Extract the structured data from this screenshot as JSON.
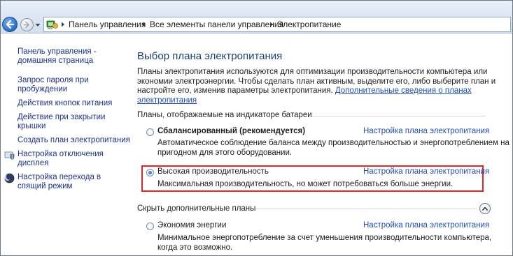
{
  "breadcrumb": {
    "items": [
      "Панель управления",
      "Все элементы панели управления",
      "Электропитание"
    ]
  },
  "icons": {
    "back": "back-arrow-icon",
    "forward": "forward-arrow-icon",
    "history": "chevron-down-icon",
    "control_panel": "control-panel-icon",
    "separator": "chevron-right-icon",
    "shield_display": "shield-icon",
    "moon_sleep": "moon-icon",
    "collapse": "chevron-up-icon"
  },
  "sidebar": {
    "items": [
      {
        "lines": [
          "Панель управления -",
          "домашняя страница"
        ]
      },
      {
        "lines": [
          "Запрос пароля при",
          "пробуждении"
        ]
      },
      {
        "lines": [
          "Действия кнопок питания"
        ]
      },
      {
        "lines": [
          "Действие при закрытии",
          "крышки"
        ]
      },
      {
        "lines": [
          "Создать план электропитания"
        ]
      },
      {
        "lines": [
          "Настройка отключения",
          "дисплея"
        ]
      },
      {
        "lines": [
          "Настройка перехода в",
          "спящий режим"
        ]
      }
    ]
  },
  "main": {
    "title": "Выбор плана электропитания",
    "intro_lines": [
      "Планы электропитания используются для оптимизации производительности компьютера или",
      "экономии электроэнергии. Чтобы сделать план активным, выделите его, либо выберите план и",
      "настройте его, изменив параметры электропитания. "
    ],
    "intro_link_lines": [
      "Дополнительные сведения о планах",
      "электропитания"
    ],
    "battery_section_title": "Планы, отображаемые на индикаторе батареи",
    "hidden_section_title": "Скрыть дополнительные планы",
    "plans": [
      {
        "name": "Сбалансированный (рекомендуется)",
        "settings_link": "Настройка плана электропитания",
        "desc_lines": [
          "Автоматическое соблюдение баланса между производительностью и энергопотреблением на",
          "пригодном для этого оборудовании."
        ],
        "selected": false
      },
      {
        "name": "Высокая производительность",
        "settings_link": "Настройка плана электропитания",
        "desc_lines": [
          "Максимальная производительность, но может потребоваться больше энергии."
        ],
        "selected": true
      },
      {
        "name": "Экономия энергии",
        "settings_link": "Настройка плана электропитания",
        "desc_lines": [
          "Минимальное энергопотребление за счет уменьшения производительности компьютера,",
          "когда это возможно."
        ],
        "selected": false
      }
    ]
  },
  "colors": {
    "link": "#1f4fb6",
    "sidebar_link": "#1e3287",
    "title": "#1e3f73",
    "highlight": "#e0252b"
  }
}
